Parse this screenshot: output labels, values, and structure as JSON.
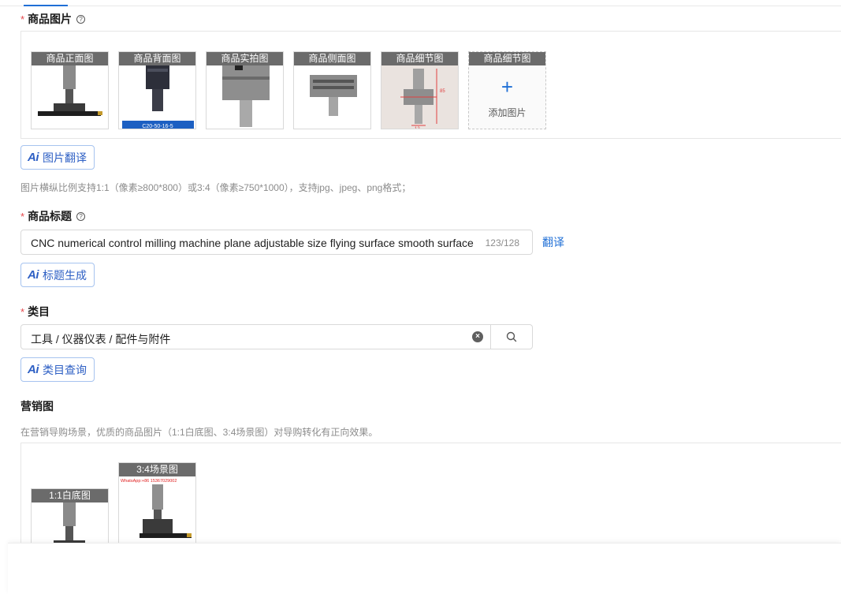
{
  "images_field": {
    "label": "商品图片",
    "required_mark": "*",
    "help_glyph": "?",
    "slots": [
      {
        "caption": "商品正面图"
      },
      {
        "caption": "商品背面图",
        "footer": "C20-50-16-5"
      },
      {
        "caption": "商品实拍图"
      },
      {
        "caption": "商品侧面图"
      },
      {
        "caption": "商品细节图",
        "dims": [
          "85",
          "12"
        ]
      },
      {
        "caption": "商品细节图"
      }
    ],
    "add_symbol": "+",
    "add_label": "添加图片",
    "ai_label": "图片翻译",
    "hint": "图片横纵比例支持1:1（像素≥800*800）或3:4（像素≥750*1000），支持jpg、jpeg、png格式；"
  },
  "title_field": {
    "label": "商品标题",
    "required_mark": "*",
    "help_glyph": "?",
    "value": "CNC numerical control milling machine plane adjustable size flying surface smooth surface tool",
    "count": "123/128",
    "translate_label": "翻译",
    "ai_label": "标题生成"
  },
  "category_field": {
    "label": "类目",
    "required_mark": "*",
    "value": "工具 / 仪器仪表 / 配件与附件",
    "clear_glyph": "×",
    "ai_label": "类目查询"
  },
  "marketing": {
    "title": "营销图",
    "hint": "在营销导购场景，优质的商品图片（1:1白底图、3:4场景图）对导购转化有正向效果。",
    "slots": [
      {
        "caption": "1:1白底图"
      },
      {
        "caption": "3:4场景图",
        "watermark": "WhatsApp:+86 15367029002"
      }
    ]
  },
  "ai_mark": "Ai",
  "colors": {
    "accent": "#1f6fd6",
    "required": "#e5484d",
    "caption_bg": "#6b6b6b"
  }
}
